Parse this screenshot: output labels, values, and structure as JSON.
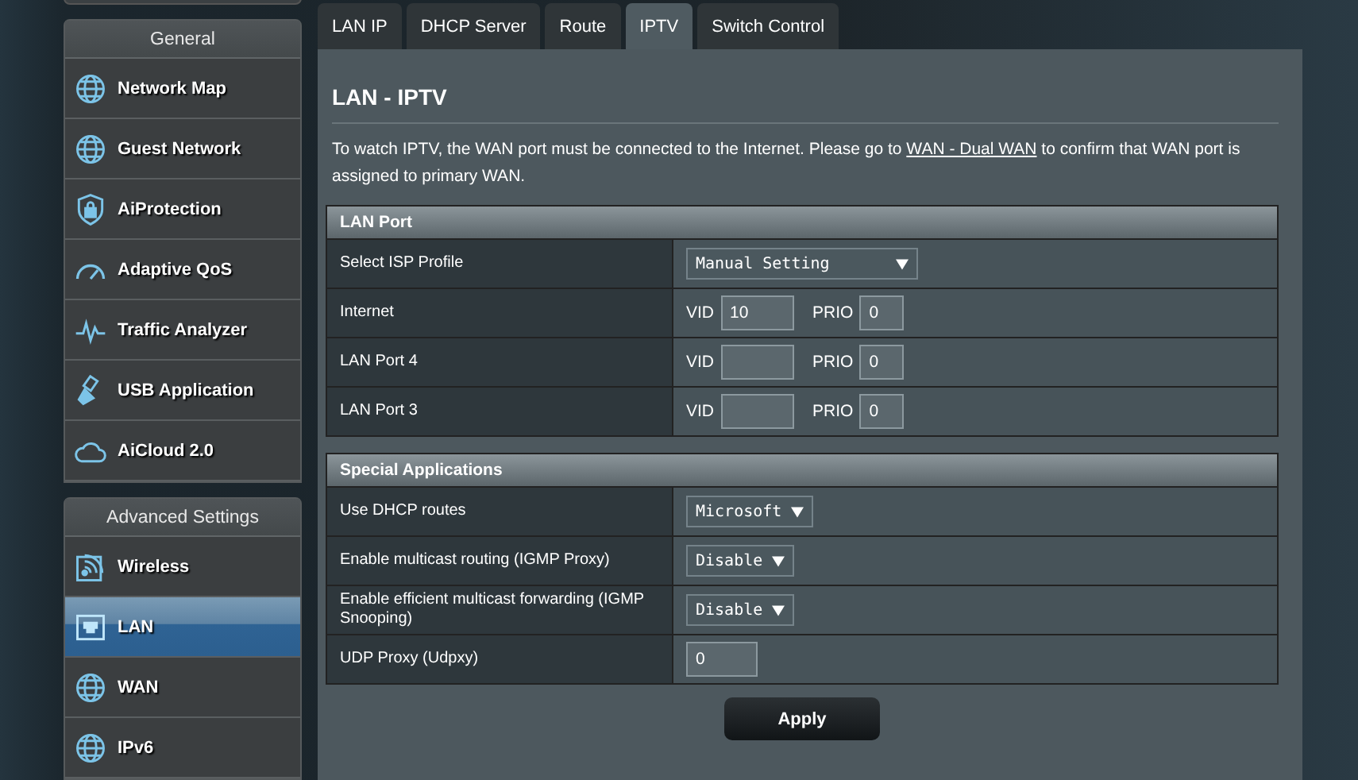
{
  "sidebar": {
    "groups": [
      {
        "title": "General",
        "items": [
          {
            "label": "Network Map",
            "selected": false
          },
          {
            "label": "Guest Network",
            "selected": false
          },
          {
            "label": "AiProtection",
            "selected": false
          },
          {
            "label": "Adaptive QoS",
            "selected": false
          },
          {
            "label": "Traffic Analyzer",
            "selected": false
          },
          {
            "label": "USB Application",
            "selected": false
          },
          {
            "label": "AiCloud 2.0",
            "selected": false
          }
        ]
      },
      {
        "title": "Advanced Settings",
        "items": [
          {
            "label": "Wireless",
            "selected": false
          },
          {
            "label": "LAN",
            "selected": true
          },
          {
            "label": "WAN",
            "selected": false
          },
          {
            "label": "IPv6",
            "selected": false
          }
        ]
      }
    ]
  },
  "tabs": [
    {
      "label": "LAN IP",
      "selected": false
    },
    {
      "label": "DHCP Server",
      "selected": false
    },
    {
      "label": "Route",
      "selected": false
    },
    {
      "label": "IPTV",
      "selected": true
    },
    {
      "label": "Switch Control",
      "selected": false
    }
  ],
  "page": {
    "title": "LAN - IPTV",
    "description": {
      "text_before": "To watch IPTV, the WAN port must be connected to the Internet. Please go to ",
      "link": "WAN - Dual WAN",
      "text_after": " to confirm that WAN port is assigned to primary WAN."
    },
    "sections": [
      {
        "title": "LAN Port",
        "rows": [
          {
            "label": "Select ISP Profile",
            "kind": "select",
            "value": "Manual Setting"
          },
          {
            "label": "Internet",
            "kind": "vid_prio",
            "vid_label": "VID",
            "vid_value": "10",
            "prio_label": "PRIO",
            "prio_value": "0"
          },
          {
            "label": "LAN Port 4",
            "kind": "vid_prio",
            "vid_label": "VID",
            "prio_label": "PRIO",
            "prio_value": "0"
          },
          {
            "label": "LAN Port 3",
            "kind": "vid_prio",
            "vid_label": "VID",
            "prio_label": "PRIO",
            "prio_value": "0"
          }
        ]
      },
      {
        "title": "Special Applications",
        "rows": [
          {
            "label": "Use DHCP routes",
            "kind": "select",
            "value": "Microsoft"
          },
          {
            "label": "Enable multicast routing (IGMP Proxy)",
            "kind": "select",
            "value": "Disable"
          },
          {
            "label": "Enable efficient multicast forwarding (IGMP Snooping)",
            "kind": "select",
            "value": "Disable"
          },
          {
            "label": "UDP Proxy (Udpxy)",
            "kind": "input",
            "value": "0"
          }
        ]
      }
    ],
    "apply_button": "Apply"
  }
}
